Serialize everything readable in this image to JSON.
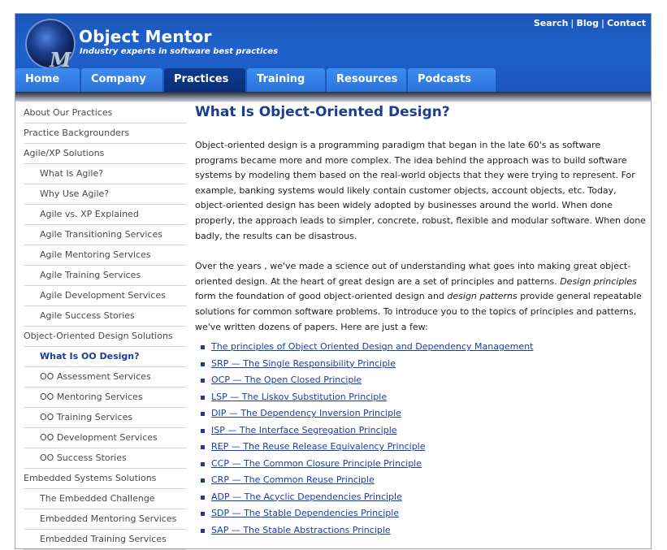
{
  "header": {
    "brand_title": "Object Mentor",
    "brand_tagline": "Industry experts in software best practices",
    "logo_letter": "M",
    "top_links": [
      "Search",
      "Blog",
      "Contact"
    ],
    "separator": "|"
  },
  "nav": {
    "tabs": [
      "Home",
      "Company",
      "Practices",
      "Training",
      "Resources",
      "Podcasts"
    ],
    "active": "Practices"
  },
  "sidebar": {
    "items": [
      {
        "label": "About Our Practices",
        "level": 0
      },
      {
        "label": "Practice Backgrounders",
        "level": 0
      },
      {
        "label": "Agile/XP Solutions",
        "level": 0
      },
      {
        "label": "What Is Agile?",
        "level": 1
      },
      {
        "label": "Why Use Agile?",
        "level": 1
      },
      {
        "label": "Agile vs. XP Explained",
        "level": 1
      },
      {
        "label": "Agile Transitioning Services",
        "level": 1
      },
      {
        "label": "Agile Mentoring Services",
        "level": 1
      },
      {
        "label": "Agile Training Services",
        "level": 1
      },
      {
        "label": "Agile Development Services",
        "level": 1
      },
      {
        "label": "Agile Success Stories",
        "level": 1
      },
      {
        "label": "Object-Oriented Design Solutions",
        "level": 0
      },
      {
        "label": "What Is OO Design?",
        "level": 1,
        "current": true
      },
      {
        "label": "OO Assessment Services",
        "level": 1
      },
      {
        "label": "OO Mentoring Services",
        "level": 1
      },
      {
        "label": "OO Training Services",
        "level": 1
      },
      {
        "label": "OO Development Services",
        "level": 1
      },
      {
        "label": "OO Success Stories",
        "level": 1
      },
      {
        "label": "Embedded Systems Solutions",
        "level": 0
      },
      {
        "label": "The Embedded Challenge",
        "level": 1
      },
      {
        "label": "Embedded Mentoring Services",
        "level": 1
      },
      {
        "label": "Embedded Training Services",
        "level": 1
      }
    ]
  },
  "main": {
    "title": "What Is Object-Oriented Design?",
    "para1": "Object-oriented design is a programming paradigm that began in the late 60's as software programs became more and more complex. The idea behind the approach was to build software systems by modeling them based on the real-world objects that they were trying to represent. For example, banking systems would likely contain customer objects, account objects, etc. Today, object-oriented design has been widely adopted by businesses around the world. When done properly, the approach leads to simpler, concrete, robust, flexible and modular software. When done badly, the results can be disastrous.",
    "para2_a": "Over the years , we've made a science out of understanding what goes into making great object-oriented design. At the heart of great design are a set of principles and patterns. ",
    "para2_em1": "Design principles",
    "para2_b": " form the foundation of good object-oriented design and ",
    "para2_em2": "design patterns",
    "para2_c": " provide general repeatable solutions for common software problems. To introduce you to the topics of principles and patterns, we've written dozens of papers. Here are just a few:",
    "links": [
      "The principles of Object Oriented Design and Dependency Management",
      "SRP — The Single Responsibility Principle",
      "OCP — The Open Closed Principle",
      "LSP — The Liskov Substitution Principle",
      "DIP — The Dependency Inversion Principle",
      "ISP — The Interface Segregation Principle",
      "REP — The Reuse Release Equivalency Principle",
      "CCP — The Common Closure Principle Principle",
      "CRP — The Common Reuse Principle",
      "ADP — The Acyclic Dependencies Principle",
      "SDP — The Stable Dependencies Principle",
      "SAP — The Stable Abstractions Principle"
    ]
  },
  "colors": {
    "header_blue": "#1e62cc",
    "tab_blue": "#2f7de6",
    "tab_active": "#0d3a8e",
    "title_blue": "#1b3d8f",
    "link_blue": "#1b3dac"
  }
}
